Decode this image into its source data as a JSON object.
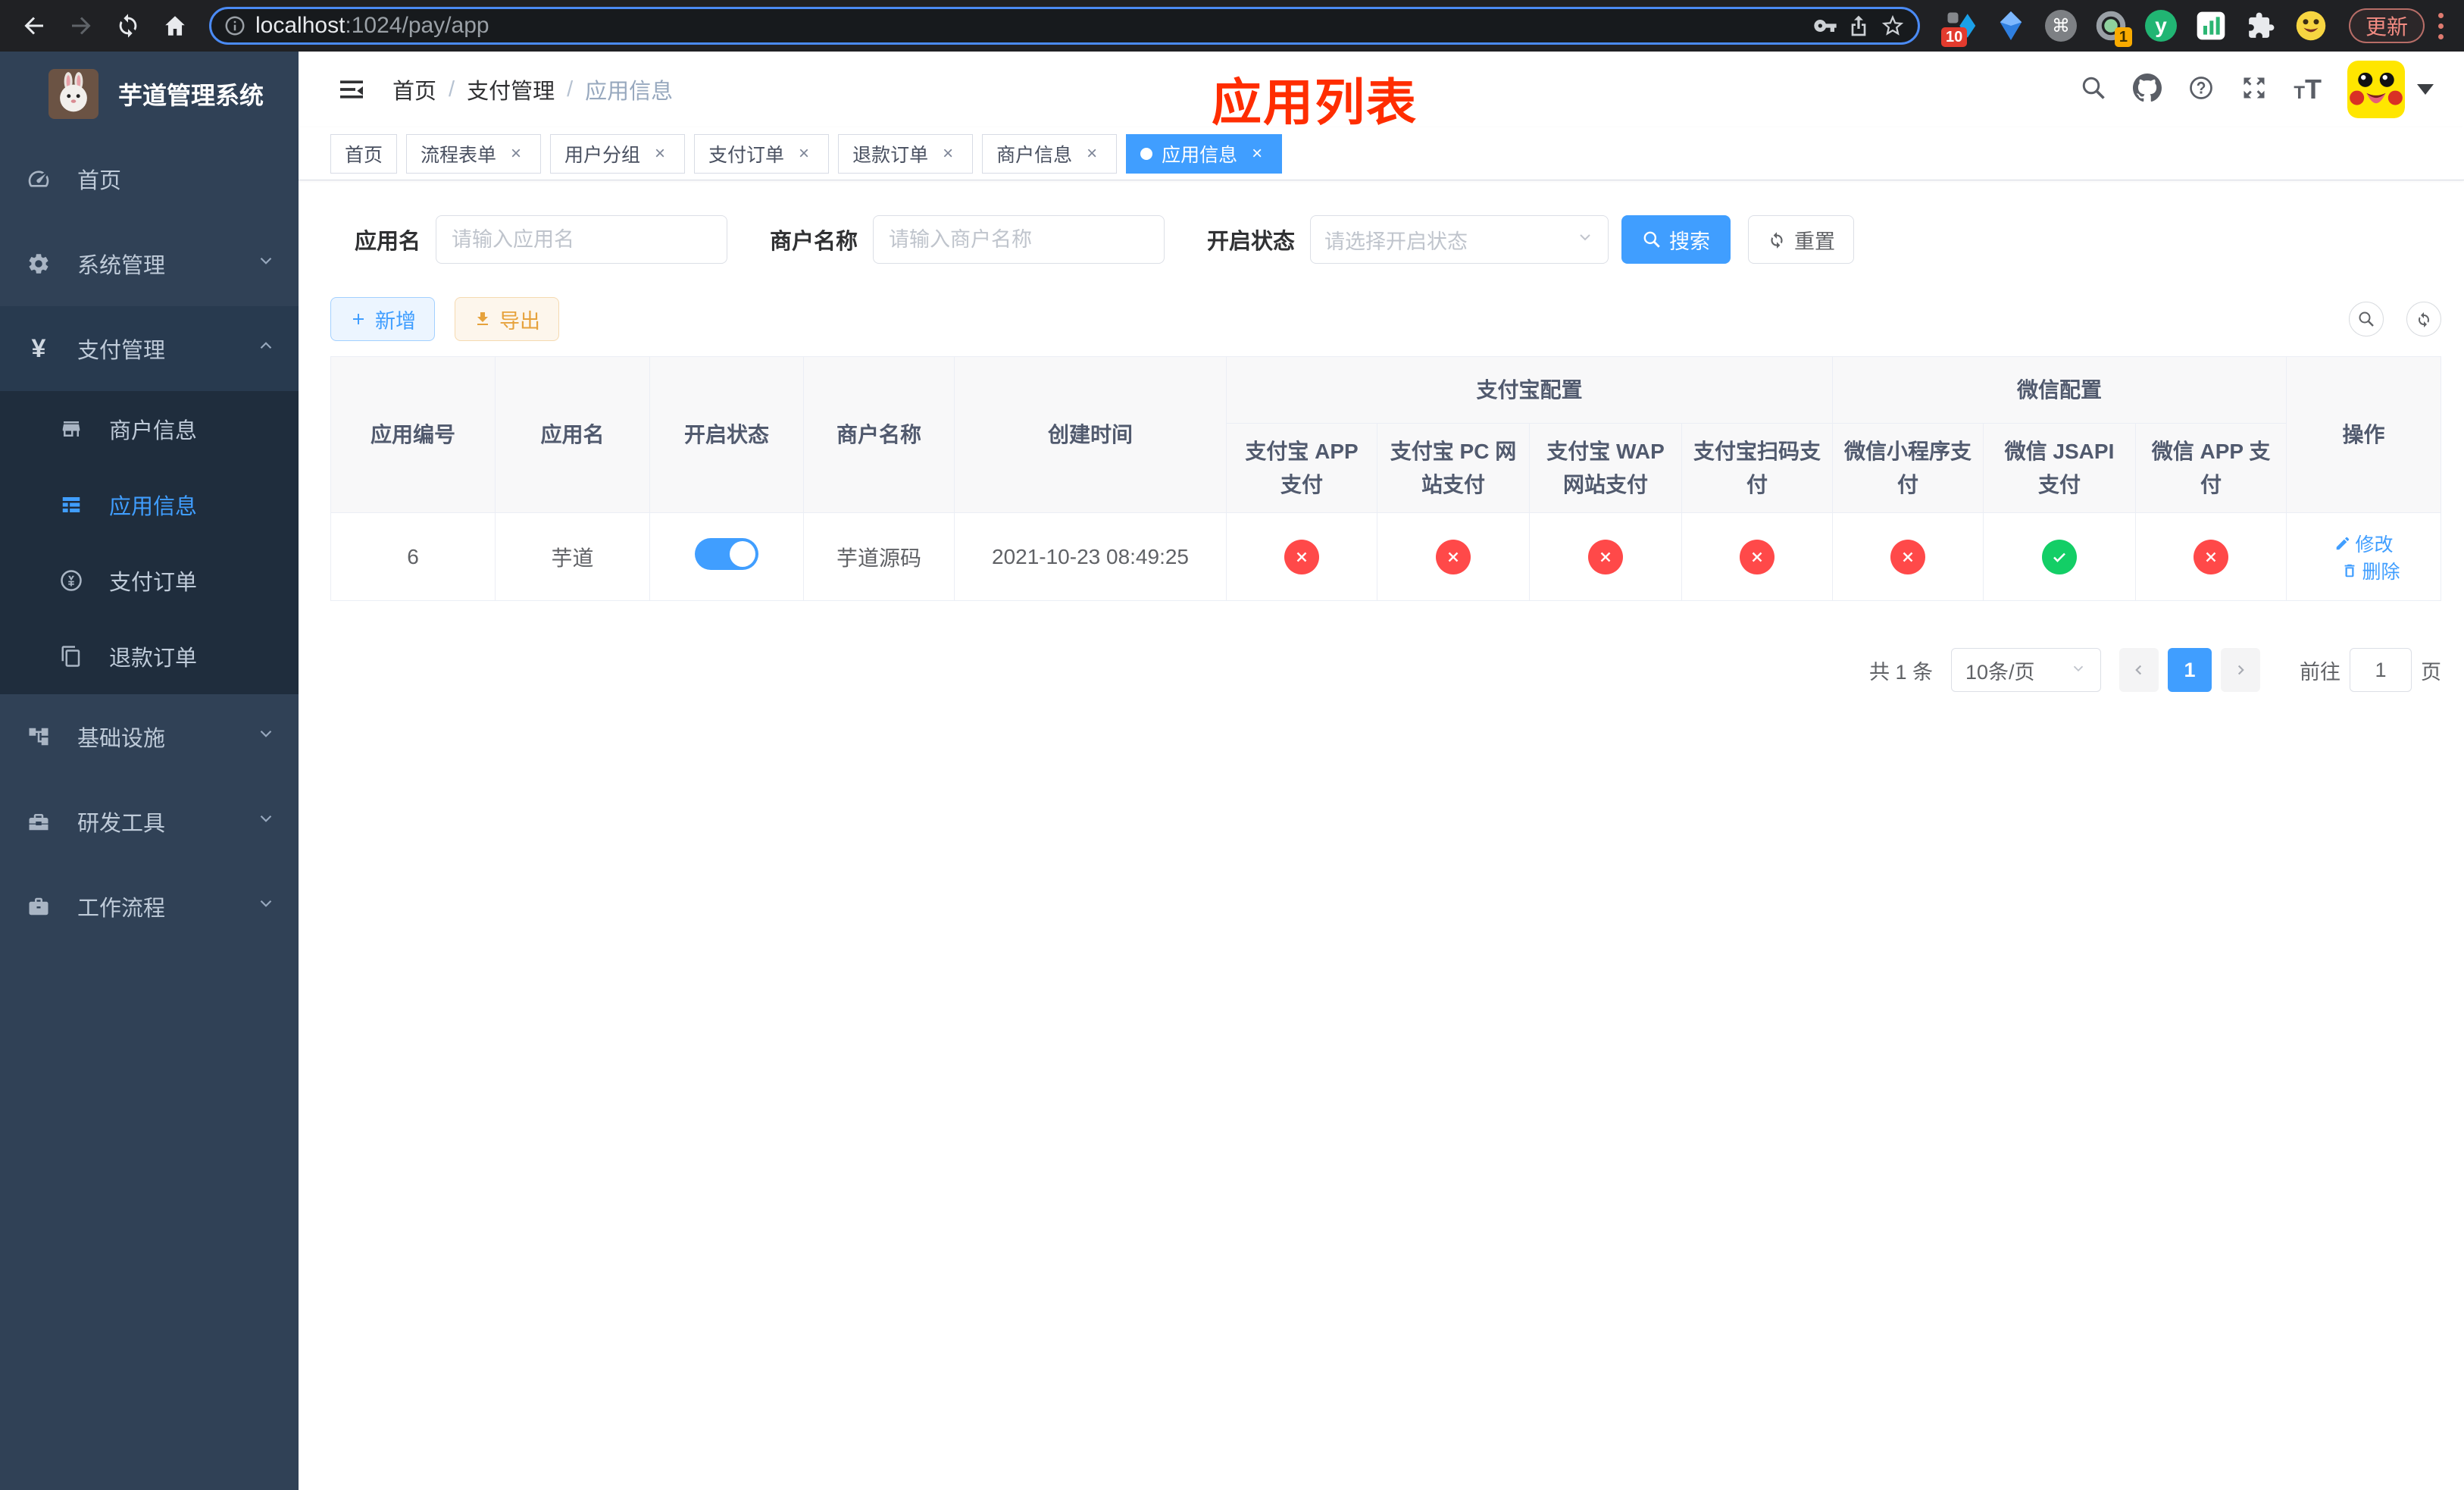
{
  "browser": {
    "url_host": "localhost",
    "url_path": ":1024/pay/app",
    "update_label": "更新",
    "extensions": {
      "tampermonkey_badge": "10",
      "proxy_badge": "1"
    }
  },
  "sidebar": {
    "app_title": "芋道管理系统",
    "menu": [
      {
        "label": "首页"
      },
      {
        "label": "系统管理"
      },
      {
        "label": "支付管理"
      },
      {
        "label": "基础设施"
      },
      {
        "label": "研发工具"
      },
      {
        "label": "工作流程"
      }
    ],
    "payment_submenu": [
      {
        "label": "商户信息"
      },
      {
        "label": "应用信息",
        "active": true
      },
      {
        "label": "支付订单"
      },
      {
        "label": "退款订单"
      }
    ]
  },
  "header": {
    "breadcrumb": [
      "首页",
      "支付管理",
      "应用信息"
    ],
    "page_title": "应用列表"
  },
  "tabs": [
    {
      "label": "首页",
      "closable": false,
      "active": false
    },
    {
      "label": "流程表单",
      "closable": true,
      "active": false
    },
    {
      "label": "用户分组",
      "closable": true,
      "active": false
    },
    {
      "label": "支付订单",
      "closable": true,
      "active": false
    },
    {
      "label": "退款订单",
      "closable": true,
      "active": false
    },
    {
      "label": "商户信息",
      "closable": true,
      "active": false
    },
    {
      "label": "应用信息",
      "closable": true,
      "active": true
    }
  ],
  "filters": {
    "app_name_label": "应用名",
    "app_name_placeholder": "请输入应用名",
    "merchant_label": "商户名称",
    "merchant_placeholder": "请输入商户名称",
    "status_label": "开启状态",
    "status_placeholder": "请选择开启状态",
    "search_label": "搜索",
    "reset_label": "重置"
  },
  "toolbar": {
    "add_label": "新增",
    "export_label": "导出"
  },
  "table": {
    "headers": {
      "app_id": "应用编号",
      "app_name": "应用名",
      "open_status": "开启状态",
      "merchant_name": "商户名称",
      "create_time": "创建时间",
      "alipay_group": "支付宝配置",
      "wechat_group": "微信配置",
      "alipay_app": "支付宝 APP 支付",
      "alipay_pc": "支付宝 PC 网站支付",
      "alipay_wap": "支付宝 WAP 网站支付",
      "alipay_scan": "支付宝扫码支付",
      "wechat_mini": "微信小程序支付",
      "wechat_jsapi": "微信 JSAPI 支付",
      "wechat_app": "微信 APP 支付",
      "actions": "操作"
    },
    "rows": [
      {
        "id": "6",
        "name": "芋道",
        "enabled": true,
        "merchant": "芋道源码",
        "created": "2021-10-23 08:49:25",
        "channels": {
          "alipay_app": false,
          "alipay_pc": false,
          "alipay_wap": false,
          "alipay_scan": false,
          "wechat_mini": false,
          "wechat_jsapi": true,
          "wechat_app": false
        },
        "edit_label": "修改",
        "delete_label": "删除"
      }
    ]
  },
  "pagination": {
    "total_text": "共 1 条",
    "page_size": "10条/页",
    "current_page": "1",
    "goto_label": "前往",
    "goto_value": "1",
    "page_unit": "页"
  },
  "colors": {
    "primary": "#409EFF",
    "success": "#13ce66",
    "danger": "#ff4949",
    "warning": "#e6a23c",
    "sidebar_bg": "#304156",
    "submenu_bg": "#1f2d3d",
    "annotation_red": "#ff2d00"
  }
}
